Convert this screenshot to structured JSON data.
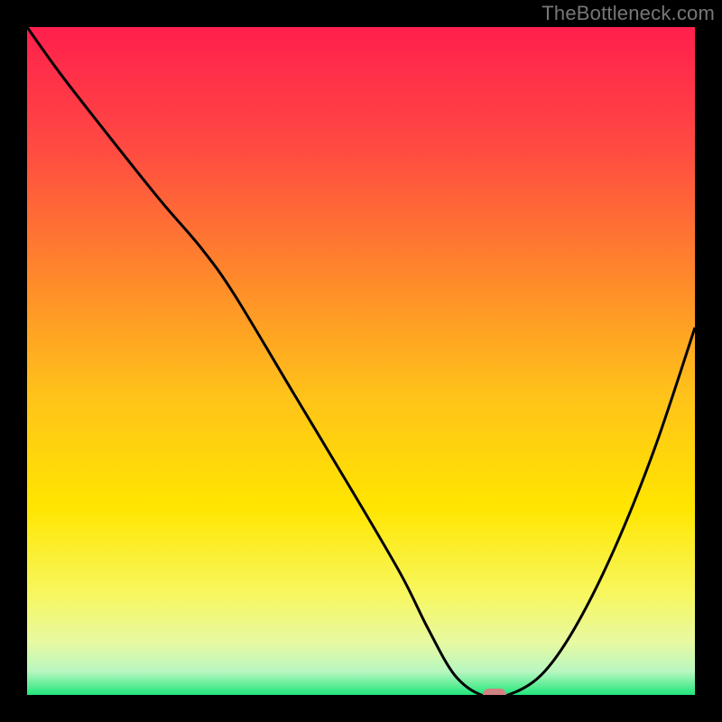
{
  "watermark": "TheBottleneck.com",
  "chart_data": {
    "type": "line",
    "title": "",
    "xlabel": "",
    "ylabel": "",
    "xlim": [
      0,
      100
    ],
    "ylim": [
      0,
      100
    ],
    "grid": false,
    "legend": false,
    "series": [
      {
        "name": "bottleneck-curve",
        "x": [
          0,
          5,
          12,
          20,
          26,
          31,
          40,
          49,
          56,
          60,
          64,
          68,
          72,
          77,
          82,
          88,
          94,
          100
        ],
        "values": [
          100,
          93,
          84,
          74,
          67,
          60,
          45,
          30,
          18,
          10,
          3,
          0,
          0,
          3,
          10,
          22,
          37,
          55
        ]
      }
    ],
    "marker": {
      "x": 70,
      "y": 0,
      "color": "#d08282"
    },
    "gradient_stops": [
      {
        "pos": 0.0,
        "color": "#ff1f4d"
      },
      {
        "pos": 0.18,
        "color": "#ff4a42"
      },
      {
        "pos": 0.38,
        "color": "#ff8a2a"
      },
      {
        "pos": 0.55,
        "color": "#ffc21a"
      },
      {
        "pos": 0.72,
        "color": "#ffe600"
      },
      {
        "pos": 0.85,
        "color": "#f7f760"
      },
      {
        "pos": 0.92,
        "color": "#e8f9a0"
      },
      {
        "pos": 0.965,
        "color": "#b8f7c0"
      },
      {
        "pos": 1.0,
        "color": "#20e67a"
      }
    ],
    "curve_color": "#000000",
    "curve_width": 3
  }
}
